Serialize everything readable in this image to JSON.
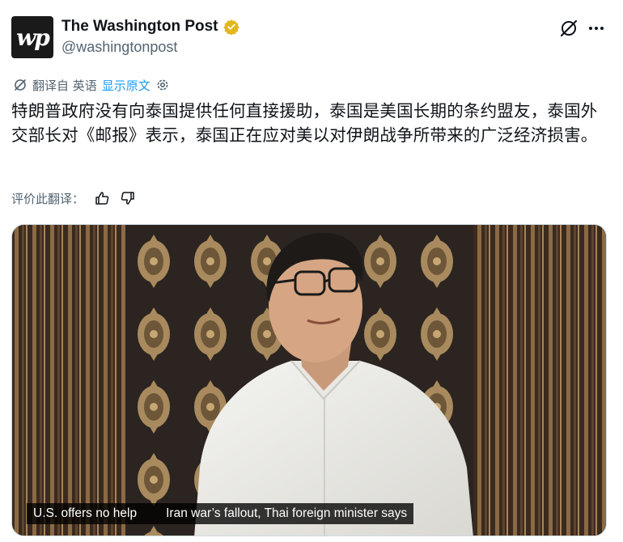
{
  "author": {
    "display_name": "The Washington Post",
    "handle": "@washingtonpost",
    "avatar_text": "wp",
    "verified_color": "#e2b719"
  },
  "translation": {
    "label": "翻译自 英语",
    "show_original": "显示原文"
  },
  "post": {
    "text": "特朗普政府没有向泰国提供任何直接援助，泰国是美国长期的条约盟友，泰国外交部长对《邮报》表示，泰国正在应对美以对伊朗战争所带来的广泛经济损害。"
  },
  "rating": {
    "label": "评价此翻译："
  },
  "media": {
    "caption_left": "U.S. offers no help",
    "caption_right": "Iran war’s fallout, Thai foreign minister says"
  },
  "colors": {
    "accent": "#1d9bf0",
    "secondary_text": "#536471"
  }
}
